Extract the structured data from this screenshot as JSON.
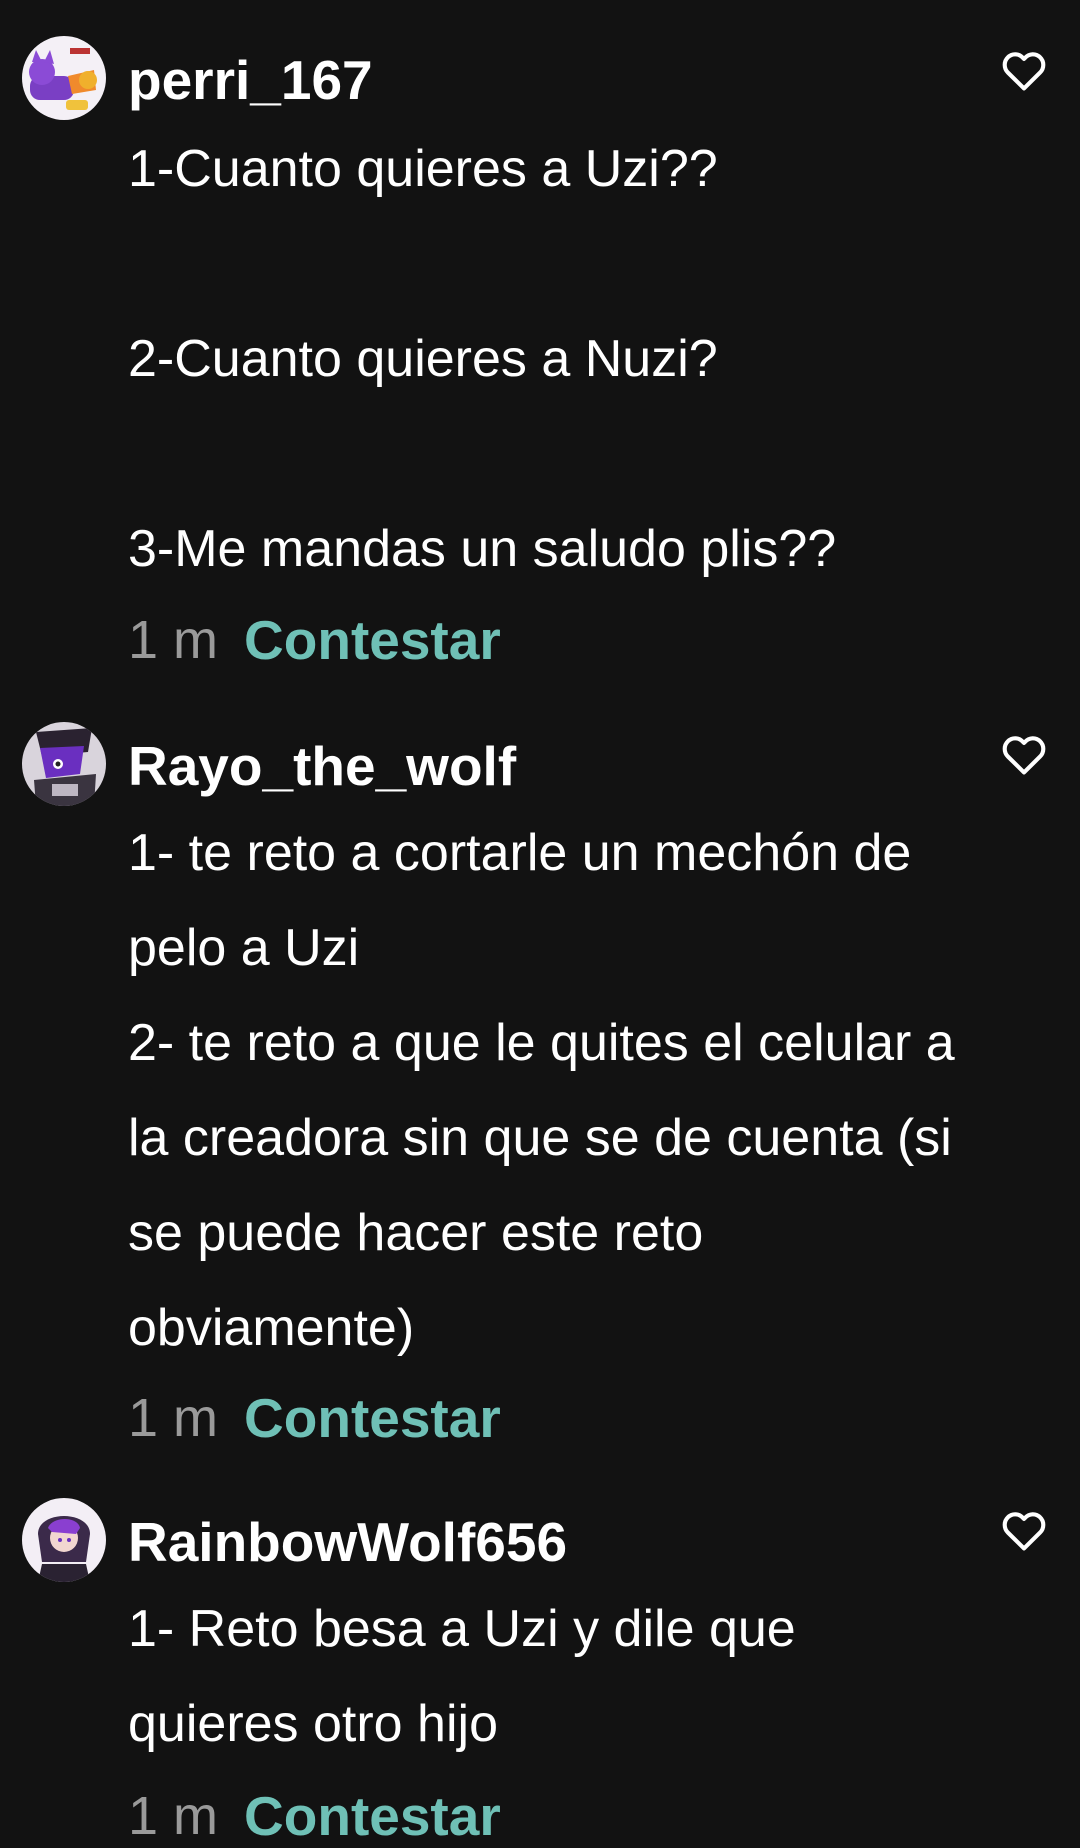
{
  "comments": [
    {
      "username": "perri_167",
      "text": "1-Cuanto quieres a Uzi??\n\n2-Cuanto quieres a Nuzi?\n\n3-Me mandas un saludo plis??",
      "time": "1 m",
      "reply_label": "Contestar",
      "like_icon": "heart-outline-icon"
    },
    {
      "username": "Rayo_the_wolf",
      "text": "1- te reto a cortarle un mechón de pelo a Uzi\n2- te reto a que le quites el celular a la creadora sin que se de cuenta (si se puede hacer este reto obviamente)",
      "time": "1 m",
      "reply_label": "Contestar",
      "like_icon": "heart-outline-icon"
    },
    {
      "username": "RainbowWolf656",
      "text": "1- Reto besa a Uzi y dile que quieres otro hijo",
      "time": "1 m",
      "reply_label": "Contestar",
      "like_icon": "heart-outline-icon"
    }
  ],
  "colors": {
    "background": "#121212",
    "text": "#ffffff",
    "timestamp": "#9a9a9a",
    "reply_accent": "#6fc0b6"
  }
}
